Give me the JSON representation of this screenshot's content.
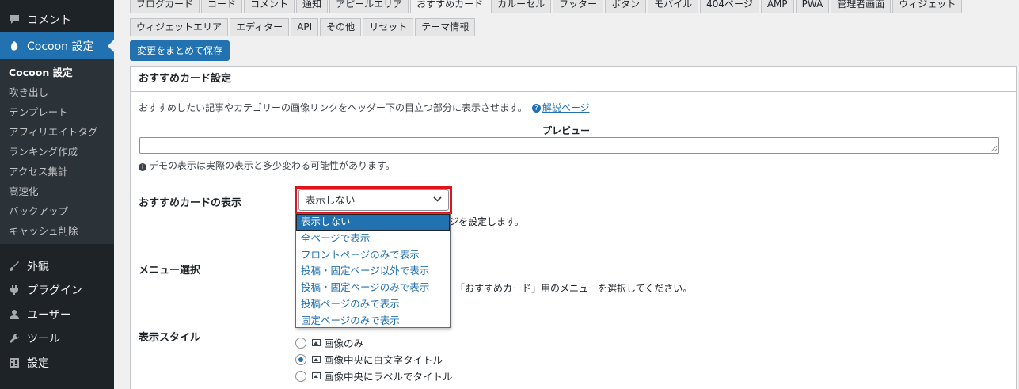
{
  "sidebar": {
    "top_items": [
      {
        "label": "コメント",
        "icon": "comment-icon"
      },
      {
        "label": "Cocoon 設定",
        "icon": "cocoon-leaf-icon"
      }
    ],
    "submenu": [
      "Cocoon 設定",
      "吹き出し",
      "テンプレート",
      "アフィリエイトタグ",
      "ランキング作成",
      "アクセス集計",
      "高速化",
      "バックアップ",
      "キャッシュ削除"
    ],
    "bottom_items": [
      {
        "label": "外観",
        "icon": "paintbrush-icon"
      },
      {
        "label": "プラグイン",
        "icon": "plugin-icon"
      },
      {
        "label": "ユーザー",
        "icon": "user-icon"
      },
      {
        "label": "ツール",
        "icon": "wrench-icon"
      },
      {
        "label": "設定",
        "icon": "settings-icon"
      }
    ]
  },
  "tabs": {
    "row1": [
      "ブログカード",
      "コード",
      "コメント",
      "通知",
      "アピールエリア",
      "おすすめカード",
      "カルーセル",
      "フッター",
      "ボタン",
      "モバイル",
      "404ページ",
      "AMP",
      "PWA",
      "管理者画面",
      "ウィジェット"
    ],
    "row2": [
      "ウィジェットエリア",
      "エディター",
      "API",
      "その他",
      "リセット",
      "テーマ情報"
    ],
    "active": "おすすめカード"
  },
  "save_button": "変更をまとめて保存",
  "panel": {
    "title": "おすすめカード設定",
    "description": "おすすめしたい記事やカテゴリーの画像リンクをヘッダー下の目立つ部分に表示させます。",
    "help_link": "解説ページ",
    "preview_label": "プレビュー",
    "demo_note": "デモの表示は実際の表示と多少変わる可能性があります。",
    "display_label": "おすすめカードの表示",
    "display_value": "表示しない",
    "display_options": [
      "表示しない",
      "全ページで表示",
      "フロントページのみで表示",
      "投稿・固定ページ以外で表示",
      "投稿・固定ページのみで表示",
      "投稿ページのみで表示",
      "固定ページのみで表示"
    ],
    "display_note_fragment": "ジを設定します。",
    "menu_label": "メニュー選択",
    "menu_note_fragment": "「おすすめカード」用のメニューを選択してください。",
    "style_label": "表示スタイル",
    "style_options": [
      {
        "label": "画像のみ",
        "checked": false
      },
      {
        "label": "画像中央に白文字タイトル",
        "checked": true
      },
      {
        "label": "画像中央にラベルでタイトル",
        "checked": false
      }
    ]
  }
}
